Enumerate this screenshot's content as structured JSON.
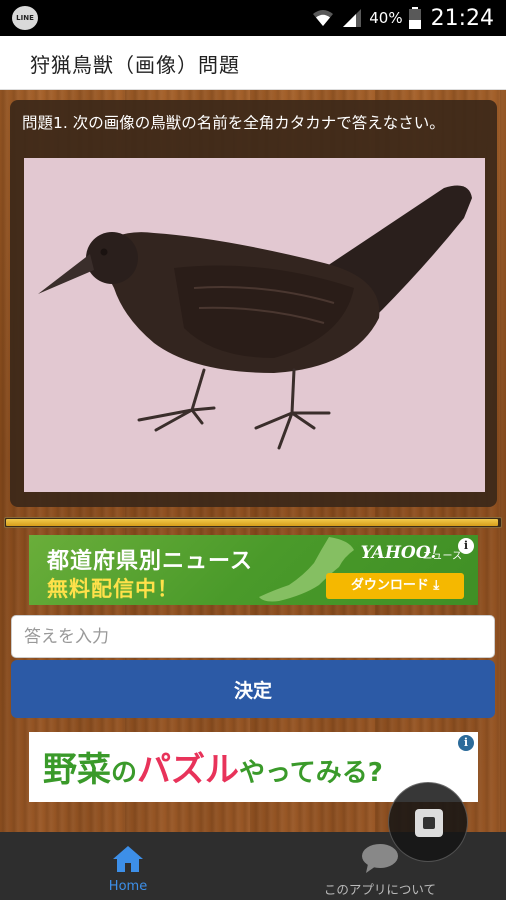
{
  "status_bar": {
    "battery_percent": "40%",
    "time": "21:24"
  },
  "header": {
    "title": "狩猟鳥獣（画像）問題"
  },
  "question": {
    "text": "問題1. 次の画像の鳥獣の名前を全角カタカナで答えなさい。"
  },
  "progress": {
    "fraction": 0.995
  },
  "ad_top": {
    "line1": "都道府県別ニュース",
    "line2": "無料配信中！",
    "logo": "YAHOO!",
    "logo_sub": "ニュース",
    "download_label": "ダウンロード ⤓",
    "info": "i"
  },
  "answer": {
    "placeholder": "答えを入力",
    "value": ""
  },
  "submit": {
    "label": "決定"
  },
  "ad_bottom": {
    "part1": "野菜",
    "part2": "の",
    "part3": "パズル",
    "part4": "やってみる?",
    "info": "i"
  },
  "nav": {
    "home_label": "Home",
    "about_label": "このアプリについて"
  },
  "colors": {
    "accent_blue": "#2c5aa6",
    "home_active": "#3d8fe8"
  }
}
